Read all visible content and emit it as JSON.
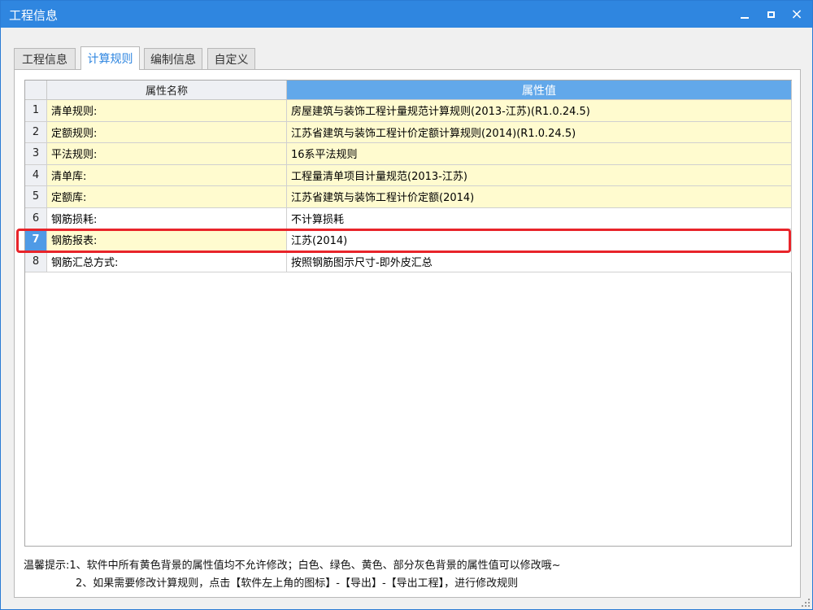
{
  "window": {
    "title": "工程信息",
    "minimize_icon": "minimize-icon",
    "maximize_icon": "maximize-icon",
    "close_icon": "close-icon",
    "close_glyph": "×"
  },
  "tabs": [
    {
      "label": "工程信息",
      "active": false
    },
    {
      "label": "计算规则",
      "active": true
    },
    {
      "label": "编制信息",
      "active": false
    },
    {
      "label": "自定义",
      "active": false
    }
  ],
  "grid": {
    "headers": {
      "num": "",
      "name": "属性名称",
      "value": "属性值"
    },
    "rows": [
      {
        "num": "1",
        "name": "清单规则:",
        "value": "房屋建筑与装饰工程计量规范计算规则(2013-江苏)(R1.0.24.5)",
        "bg": "yellow"
      },
      {
        "num": "2",
        "name": "定额规则:",
        "value": "江苏省建筑与装饰工程计价定额计算规则(2014)(R1.0.24.5)",
        "bg": "yellow"
      },
      {
        "num": "3",
        "name": "平法规则:",
        "value": "16系平法规则",
        "bg": "yellow"
      },
      {
        "num": "4",
        "name": "清单库:",
        "value": "工程量清单项目计量规范(2013-江苏)",
        "bg": "yellow"
      },
      {
        "num": "5",
        "name": "定额库:",
        "value": "江苏省建筑与装饰工程计价定额(2014)",
        "bg": "yellow"
      },
      {
        "num": "6",
        "name": "钢筋损耗:",
        "value": "不计算损耗",
        "bg": "white"
      },
      {
        "num": "7",
        "name": "钢筋报表:",
        "value": "江苏(2014)",
        "bg": "yellow",
        "selected": true
      },
      {
        "num": "8",
        "name": "钢筋汇总方式:",
        "value": "按照钢筋图示尺寸-即外皮汇总",
        "bg": "white"
      }
    ]
  },
  "hints": {
    "line1": "温馨提示:1、软件中所有黄色背景的属性值均不允许修改；白色、绿色、黄色、部分灰色背景的属性值可以修改哦~",
    "line2": "2、如果需要修改计算规则，点击【软件左上角的图标】-【导出】-【导出工程】，进行修改规则"
  },
  "colors": {
    "titlebar": "#2f86e0",
    "header_value": "#62a8ea",
    "yellow_cell": "#fffbcf",
    "highlight": "#e8242a"
  }
}
